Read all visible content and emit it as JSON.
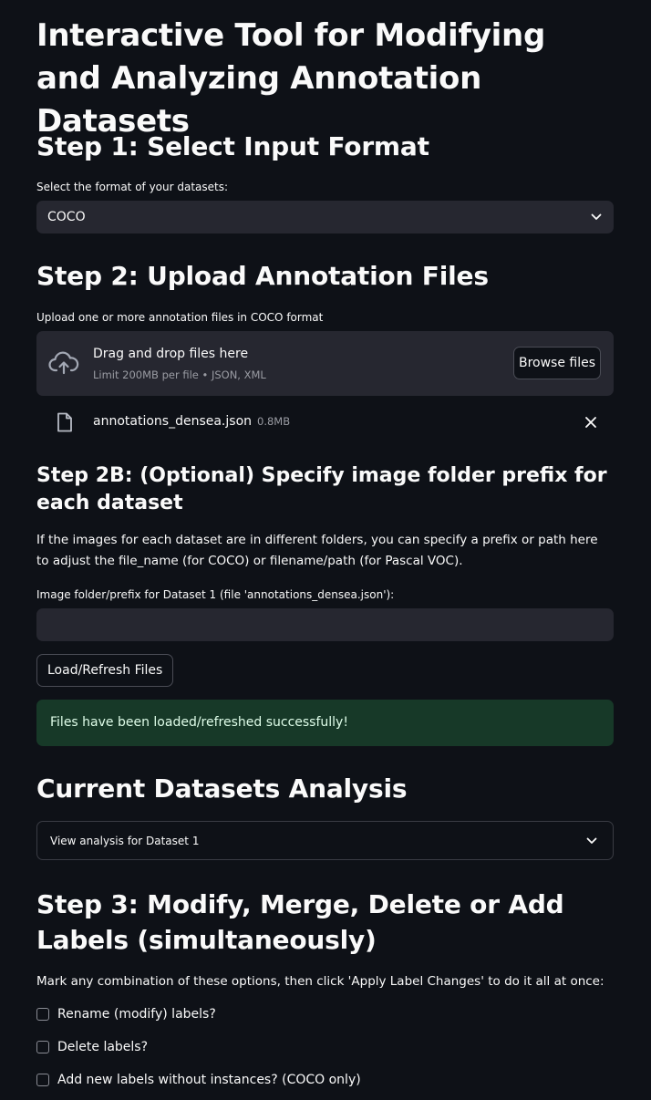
{
  "title": "Interactive Tool for Modifying and Analyzing Annotation Datasets",
  "step1": {
    "heading": "Step 1: Select Input Format",
    "label": "Select the format of your datasets:",
    "selected": "COCO"
  },
  "step2": {
    "heading": "Step 2: Upload Annotation Files",
    "label": "Upload one or more annotation files in COCO format",
    "drop_title": "Drag and drop files here",
    "drop_sub": "Limit 200MB per file • JSON, XML",
    "browse_label": "Browse files",
    "file_name": "annotations_densea.json",
    "file_size": "0.8MB"
  },
  "step2b": {
    "heading": "Step 2B: (Optional) Specify image folder prefix for each dataset",
    "description": "If the images for each dataset are in different folders, you can specify a prefix or path here to adjust the file_name (for COCO) or filename/path (for Pascal VOC).",
    "input_label": "Image folder/prefix for Dataset 1 (file 'annotations_densea.json'):",
    "input_value": "",
    "load_button": "Load/Refresh Files",
    "success_message": "Files have been loaded/refreshed successfully!"
  },
  "analysis": {
    "heading": "Current Datasets Analysis",
    "expander_label": "View analysis for Dataset 1"
  },
  "step3": {
    "heading": "Step 3: Modify, Merge, Delete or Add Labels (simultaneously)",
    "description": "Mark any combination of these options, then click 'Apply Label Changes' to do it all at once:",
    "options": [
      "Rename (modify) labels?",
      "Delete labels?",
      "Add new labels without instances? (COCO only)"
    ]
  },
  "colors": {
    "background": "#0e1117",
    "widget": "#262730",
    "success_bg": "#173928",
    "success_text": "#dffde9"
  }
}
